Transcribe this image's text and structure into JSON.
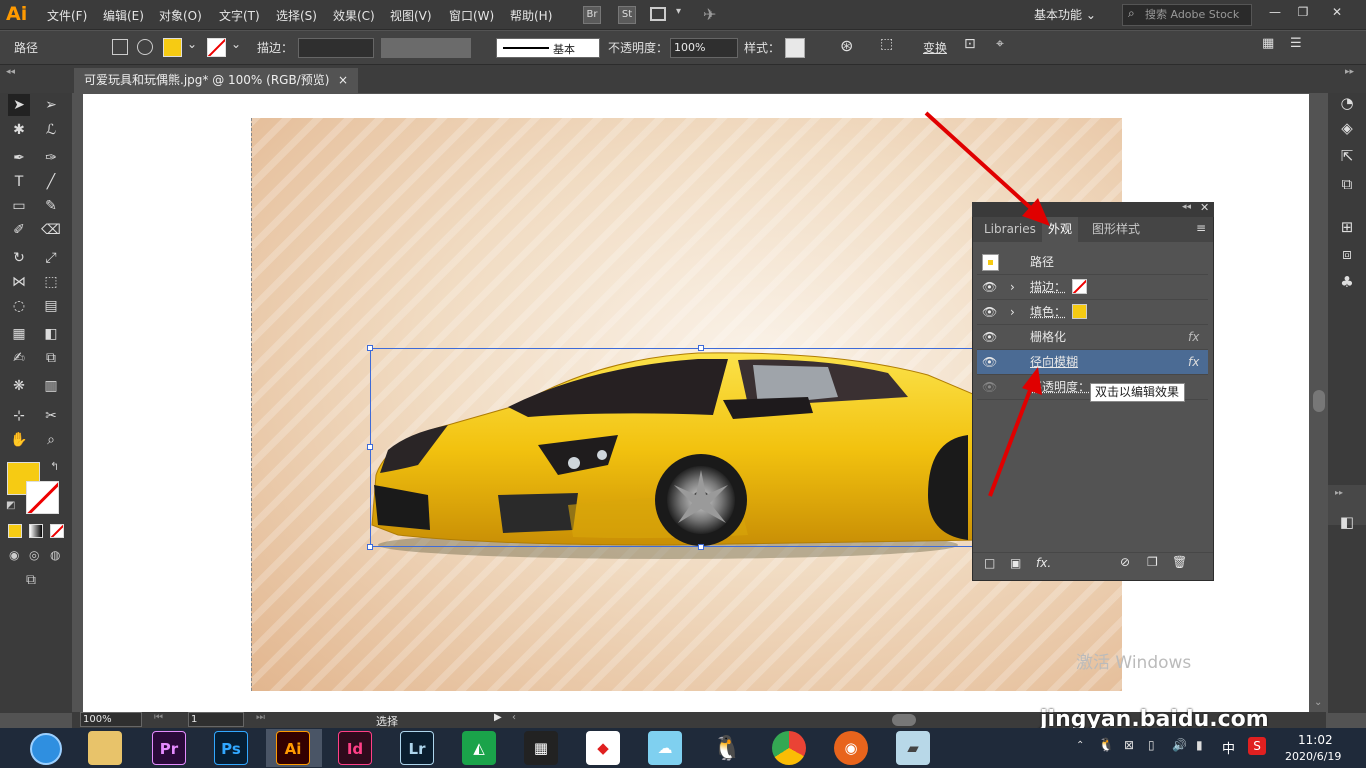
{
  "menubar": {
    "logo": "Ai",
    "items": [
      "文件(F)",
      "编辑(E)",
      "对象(O)",
      "文字(T)",
      "选择(S)",
      "效果(C)",
      "视图(V)",
      "窗口(W)",
      "帮助(H)"
    ],
    "br": "Br",
    "st": "St",
    "workspace": "基本功能",
    "search_placeholder": "搜索 Adobe Stock"
  },
  "controlbar": {
    "selection_type": "路径",
    "fill_color": "#f6cb13",
    "stroke_label": "描边：",
    "stroke_style": "基本",
    "opacity_label": "不透明度：",
    "opacity_value": "100%",
    "style_label": "样式：",
    "transform_label": "变换"
  },
  "document": {
    "tab_title": "可爱玩具和玩偶熊.jpg* @ 100% (RGB/预览)",
    "close_glyph": "×"
  },
  "appearance_panel": {
    "tabs": [
      "Libraries",
      "外观",
      "图形样式"
    ],
    "active_tab": "外观",
    "object": "路径",
    "rows": [
      {
        "label": "描边：",
        "type": "stroke"
      },
      {
        "label": "填色：",
        "type": "fill",
        "color": "#f6cb13"
      },
      {
        "label": "栅格化",
        "type": "effect",
        "fx": "fx"
      },
      {
        "label": "径向模糊",
        "type": "effect",
        "fx": "fx",
        "selected": true
      },
      {
        "label": "不透明度：",
        "type": "opacity"
      }
    ],
    "tooltip": "双击以编辑效果"
  },
  "statusbar": {
    "zoom": "100%",
    "page": "1",
    "tool": "选择"
  },
  "toolbox": {
    "fill_color": "#f6cb13"
  },
  "taskbar": {
    "apps": [
      "Pr",
      "Ps",
      "Ai",
      "Id",
      "Lr"
    ],
    "ime": "中",
    "time": "11:02",
    "date": "2020/6/19"
  },
  "watermark": {
    "activate": "激活 Windows",
    "site": "jingyan.baidu.com"
  }
}
